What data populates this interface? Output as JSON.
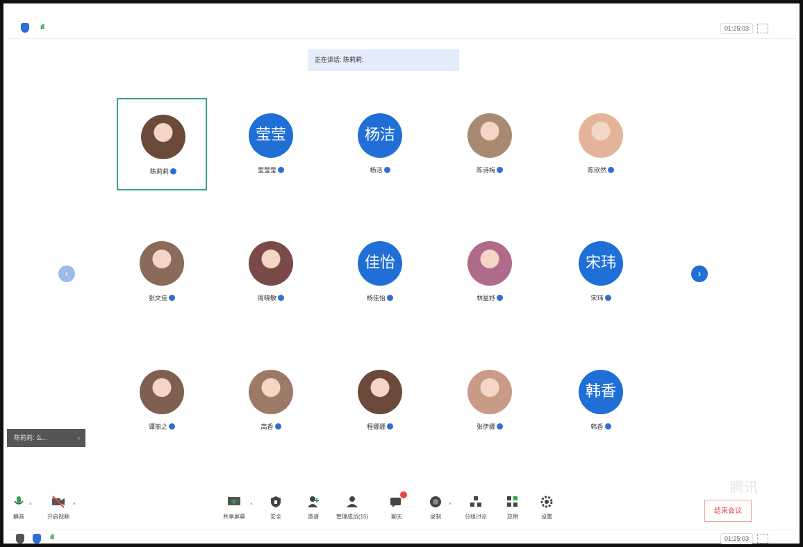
{
  "top_bar": {
    "timer": "01:25:03"
  },
  "speaking": {
    "text": "正在讲话: 陈莉莉;"
  },
  "participants": [
    {
      "name": "陈莉莉",
      "avatar_kind": "photo",
      "active": true
    },
    {
      "name": "莹莹莹",
      "avatar_kind": "text",
      "avatar_text": "莹莹"
    },
    {
      "name": "杨洁",
      "avatar_kind": "text",
      "avatar_text": "杨洁"
    },
    {
      "name": "陈诗梅",
      "avatar_kind": "photo"
    },
    {
      "name": "陈欣然",
      "avatar_kind": "photo"
    },
    {
      "name": "张文佳",
      "avatar_kind": "photo"
    },
    {
      "name": "周晓敏",
      "avatar_kind": "photo"
    },
    {
      "name": "杨佳怡",
      "avatar_kind": "text",
      "avatar_text": "佳怡"
    },
    {
      "name": "林星妤",
      "avatar_kind": "photo"
    },
    {
      "name": "宋玮",
      "avatar_kind": "text",
      "avatar_text": "宋玮"
    },
    {
      "name": "谭丽之",
      "avatar_kind": "photo"
    },
    {
      "name": "高香",
      "avatar_kind": "photo"
    },
    {
      "name": "程娜娜",
      "avatar_kind": "photo"
    },
    {
      "name": "张伊娜",
      "avatar_kind": "photo"
    },
    {
      "name": "韩香",
      "avatar_kind": "text",
      "avatar_text": "韩香"
    }
  ],
  "nav": {
    "prev": "‹",
    "next": "›"
  },
  "chat_popup": {
    "text": "陈莉莉: 么..."
  },
  "toolbar": {
    "left": [
      {
        "label": "静音",
        "icon": "mic-icon"
      },
      {
        "label": "开启视频",
        "icon": "video-off-icon"
      }
    ],
    "center": [
      {
        "label": "共享屏幕",
        "icon": "share-screen-icon"
      },
      {
        "label": "安全",
        "icon": "security-icon"
      },
      {
        "label": "邀请",
        "icon": "invite-icon"
      },
      {
        "label": "管理成员(15)",
        "icon": "members-icon"
      },
      {
        "label": "聊天",
        "icon": "chat-icon"
      },
      {
        "label": "录制",
        "icon": "record-icon"
      },
      {
        "label": "分组讨论",
        "icon": "breakout-icon"
      },
      {
        "label": "应用",
        "icon": "apps-icon"
      },
      {
        "label": "设置",
        "icon": "settings-icon"
      }
    ],
    "end_label": "结束会议"
  },
  "watermark": "腾讯",
  "bottom_bar": {
    "timer": "01:25:03"
  },
  "colors": {
    "accent": "#1f6fd6",
    "active_border": "#3aa57a",
    "danger": "#e84545"
  }
}
